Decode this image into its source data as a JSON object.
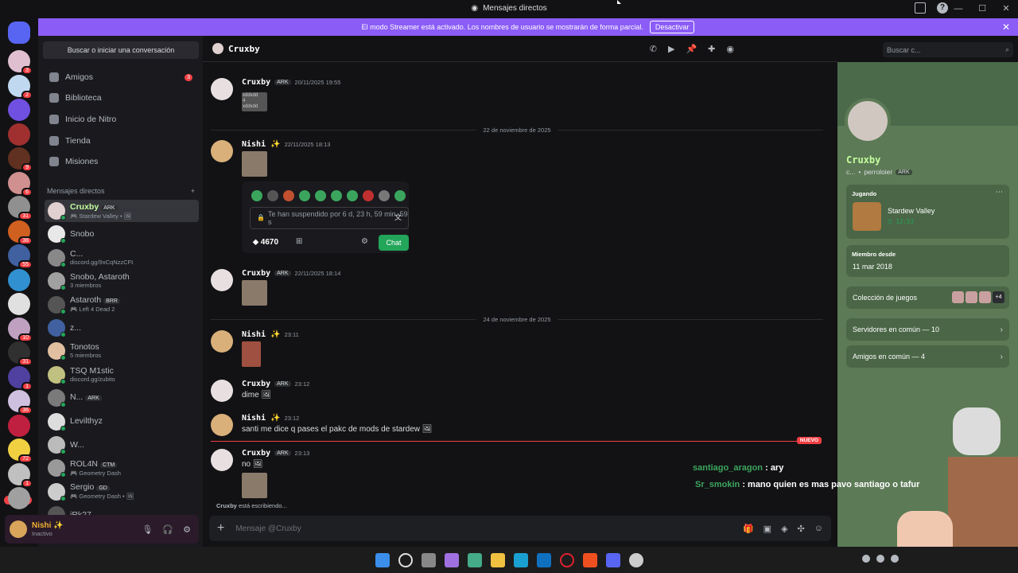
{
  "window": {
    "title": "Mensajes directos"
  },
  "banner": {
    "text": "El modo Streamer está activado. Los nombres de usuario se mostrarán de forma parcial.",
    "button": "Desactivar"
  },
  "servers": {
    "badges": [
      "3",
      "2",
      "",
      "",
      "9",
      "6",
      "31",
      "38",
      "55",
      "",
      "",
      "10",
      "31",
      "1",
      "36",
      "",
      "72",
      "1",
      ""
    ],
    "nuevo": "NUEVO"
  },
  "sidebar": {
    "search": "Buscar o iniciar una conversación",
    "nav": [
      {
        "label": "Amigos",
        "badge": "3"
      },
      {
        "label": "Biblioteca"
      },
      {
        "label": "Inicio de Nitro"
      },
      {
        "label": "Tienda"
      },
      {
        "label": "Misiones"
      }
    ],
    "dm_header": "Mensajes directos",
    "dm_add": "+",
    "dms": [
      {
        "name": "Cruxby",
        "tag": "ARK",
        "sub": "🎮 Stardew Valley • 🖼",
        "active": true
      },
      {
        "name": "Snobo",
        "sub": ""
      },
      {
        "name": "C...",
        "sub": "discord.gg/9xCqNzzCFt"
      },
      {
        "name": "Snobo, Astaroth",
        "sub": "3 miembros"
      },
      {
        "name": "Astaroth",
        "tag": "BRR",
        "sub": "🎮 Left 4 Dead 2"
      },
      {
        "name": "z...",
        "sub": ""
      },
      {
        "name": "Tonotos",
        "sub": "5 miembros"
      },
      {
        "name": "TSQ M1stic",
        "sub": "discord.gg/zubito"
      },
      {
        "name": "N...",
        "tag": "ARK",
        "sub": ""
      },
      {
        "name": "Levilthyz",
        "sub": ""
      },
      {
        "name": "W...",
        "sub": ""
      },
      {
        "name": "ROL4N",
        "tag": "CTM",
        "sub": "🎮 Geometry Dash"
      },
      {
        "name": "Sergio",
        "tag": "GD",
        "sub": "🎮 Geometry Dash • 🖼"
      },
      {
        "name": "iRk27",
        "sub": ""
      }
    ],
    "user": {
      "name": "Nishi ✨",
      "status": "Inactivo"
    }
  },
  "chat": {
    "recipient": "Cruxby",
    "search_placeholder": "Buscar c...",
    "messages": [
      {
        "name": "Cruxby",
        "tag": "ARK",
        "time": "20/11/2025 19:55",
        "text": ""
      },
      {
        "name": "Nishi ✨",
        "tag": "",
        "time": "22/11/2025 18:13",
        "text": ""
      },
      {
        "name": "Cruxby",
        "tag": "ARK",
        "time": "22/11/2025 18:14",
        "text": ""
      },
      {
        "name": "Nishi ✨",
        "tag": "",
        "time": "23:11",
        "text": ""
      },
      {
        "name": "Cruxby",
        "tag": "ARK",
        "time": "23:12",
        "text": "dime 🖼"
      },
      {
        "name": "Nishi ✨",
        "tag": "",
        "time": "23:12",
        "text": "santi me dice q pases el pakc de mods de stardew 🖼"
      },
      {
        "name": "Cruxby",
        "tag": "ARK",
        "time": "23:13",
        "text": "no 🖼"
      }
    ],
    "image_caption": "xddxdd\n4\nxddxdd",
    "dividers": [
      "22 de noviembre de 2025",
      "24 de noviembre de 2025"
    ],
    "new_pill": "NUEVO",
    "embed": {
      "input": "Te han suspendido por 6 d, 23 h, 59 min, 59 s",
      "points": "4670",
      "chat_button": "Chat"
    },
    "typing": {
      "name": "Cruxby",
      "text": "está escribiendo..."
    },
    "composer_placeholder": "Mensaje @Cruxby"
  },
  "overlay": {
    "line1_user": "santiago_aragon",
    "line1_text": ": ary",
    "line2_user": "Sr_smokin",
    "line2_text": ": mano quien es mas pavo santiago o tafur"
  },
  "profile": {
    "name": "Cruxby",
    "sub_prefix": "c...",
    "username": "perroloier",
    "tag": "ARK",
    "activity_header": "Jugando",
    "game": "Stardew Valley",
    "game_time": "12:53",
    "member_header": "Miembro desde",
    "member_date": "11 mar 2018",
    "games_collection": "Colección de juegos",
    "games_extra": "+4",
    "servers_common": "Servidores en común — 10",
    "friends_common": "Amigos en común — 4"
  },
  "colors": {
    "accent": "#8b5cf6",
    "online": "#23a55a",
    "danger": "#f23f43",
    "profile_bg": "#5c7a56"
  }
}
